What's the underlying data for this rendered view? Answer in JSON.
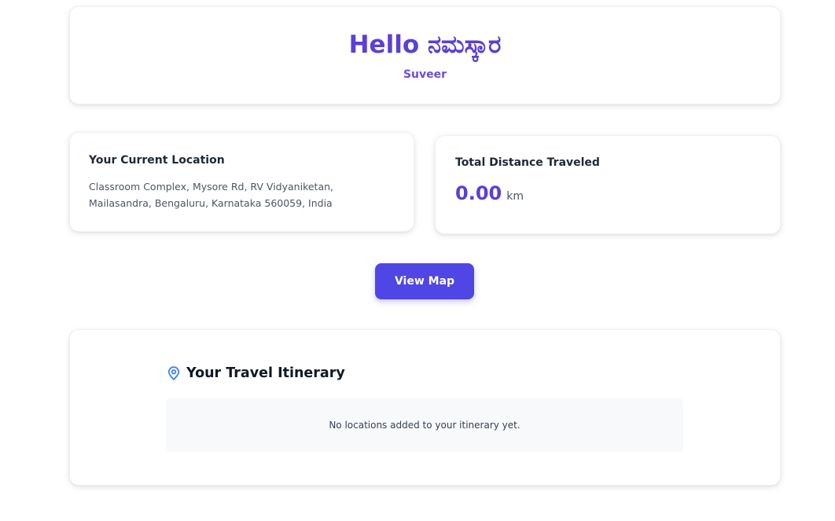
{
  "greeting": {
    "title": "Hello ನಮಸ್ಕಾರ",
    "name": "Suveer"
  },
  "location": {
    "heading": "Your Current Location",
    "address": "Classroom Complex, Mysore Rd, RV Vidyaniketan, Mailasandra, Bengaluru, Karnataka 560059, India"
  },
  "distance": {
    "heading": "Total Distance Traveled",
    "value": "0.00",
    "unit": "km"
  },
  "actions": {
    "view_map_label": "View Map"
  },
  "itinerary": {
    "title": "Your Travel Itinerary",
    "icon": "location-pin-icon",
    "empty_message": "No locations added to your itinerary yet."
  },
  "colors": {
    "accent": "#5b3fd6",
    "button": "#5046e5",
    "pin": "#3b82f6"
  }
}
